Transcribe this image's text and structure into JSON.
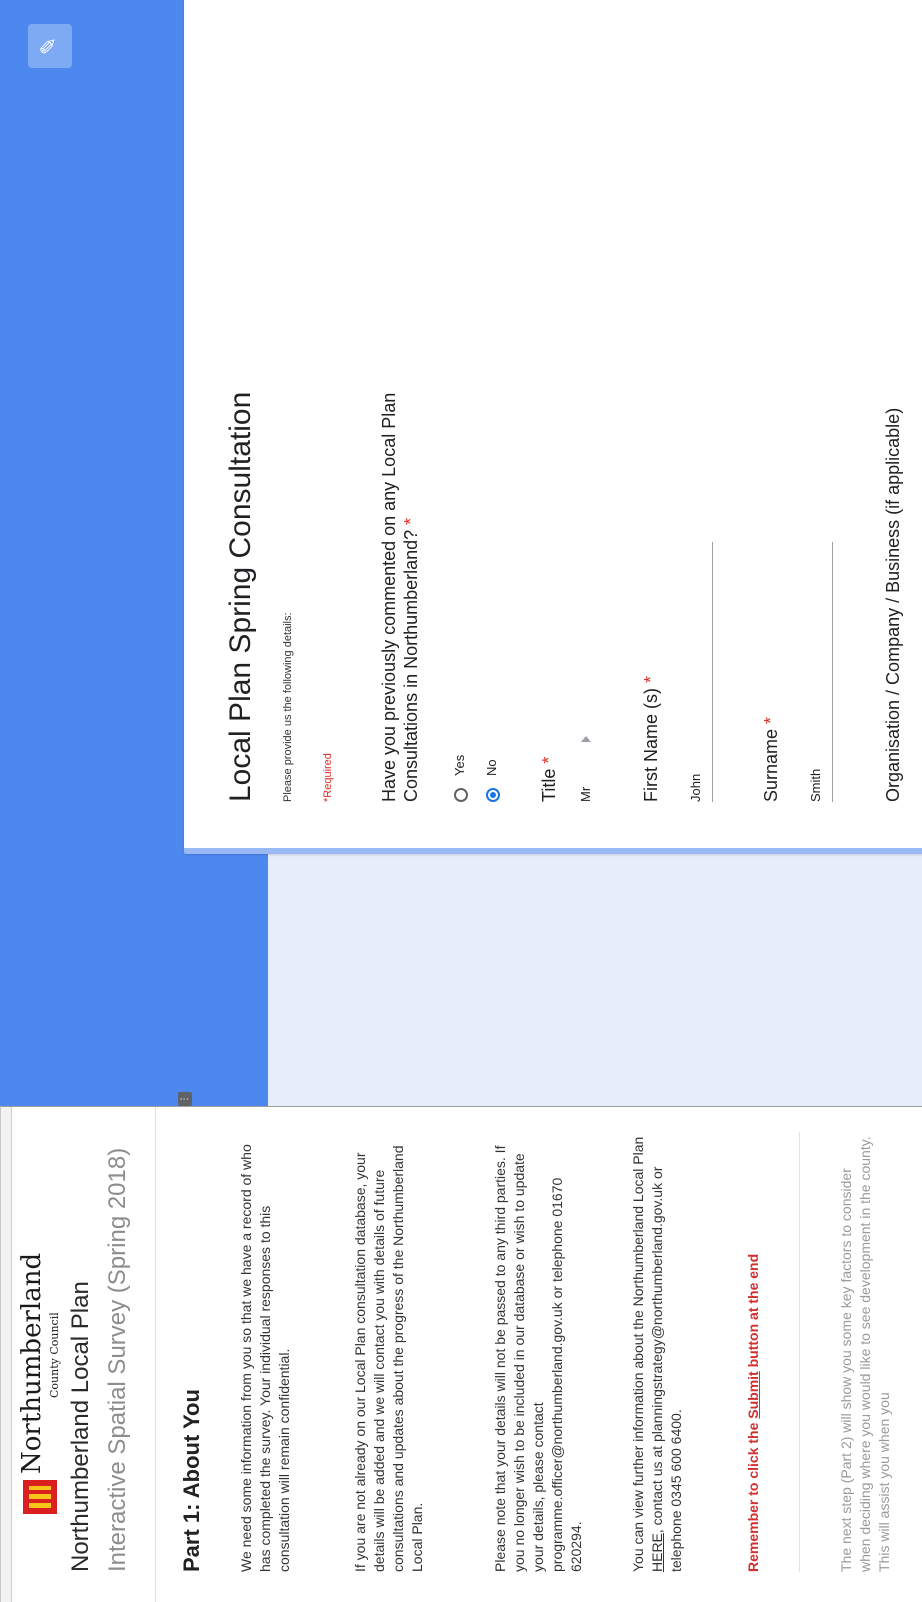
{
  "sidebar": {
    "logo": {
      "name": "Northumberland",
      "sub": "County Council"
    },
    "app_title": "Northumberland Local Plan",
    "app_subtitle": "Interactive Spatial Survey (Spring 2018)",
    "part_heading": "Part 1: About You",
    "paragraph_1": "We need some information from you so that we have a record of who has completed the survey. Your individual responses to this consultation will remain confidential.",
    "paragraph_2": "If you are not already on our Local Plan consultation database, your details will be added and we will contact you with details of future consultations and updates about the progress of the Northumberland Local Plan.",
    "paragraph_3": "Please note that your details will not be passed to any third parties. If you no longer wish to be included in our database or wish to update your details, please contact programme.officer@northumberland.gov.uk or telephone 01670 620294.",
    "paragraph_4_pre": "You can view further information about the Northumberland Local Plan ",
    "paragraph_4_link": "HERE",
    "paragraph_4_post": ", contact us at planningstrategy@northumberland.gov.uk or telephone 0345 600 6400.",
    "reminder_pre": "Remember to click the ",
    "reminder_link": "Submit",
    "reminder_post": " button at the end",
    "next_step": "The next step (Part 2) will show you some key factors to consider when deciding where you would like to see development in the county. This will assist you when you"
  },
  "form": {
    "title": "Local Plan Spring Consultation",
    "description": "Please provide us the following details:",
    "required_note": "*Required",
    "q1": {
      "label": "Have you previously commented on any Local Plan Consultations in Northumberland?",
      "required_mark": "*",
      "options": [
        "Yes",
        "No"
      ],
      "selected": "No"
    },
    "title_field": {
      "label": "Title",
      "required_mark": "*",
      "value": "Mr"
    },
    "first_name": {
      "label": "First Name (s)",
      "required_mark": "*",
      "value": "John"
    },
    "surname": {
      "label": "Surname",
      "required_mark": "*",
      "value": "Smith"
    },
    "organisation": {
      "label": "Organisation / Company / Business (if applicable)"
    }
  },
  "colors": {
    "banner": "#4d88ef",
    "background": "#e8edfb",
    "required": "#d93025",
    "reminder": "#d32f2f"
  },
  "icons": {
    "edit": "pencil-icon",
    "handle": "drag-handle-icon"
  }
}
